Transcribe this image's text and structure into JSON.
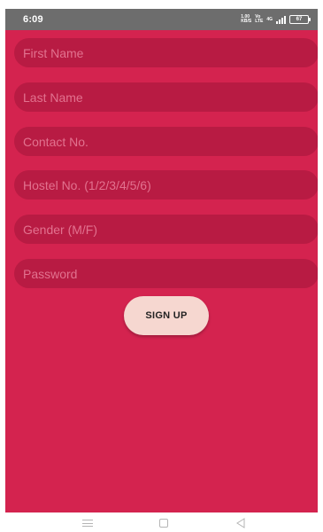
{
  "status_bar": {
    "time": "6:09",
    "speed_value": "1.00",
    "speed_unit": "KB/S",
    "net_top": "Vo",
    "net_bottom": "LTE",
    "signal_label": "4G",
    "battery": "67"
  },
  "form": {
    "first_name_placeholder": "First Name",
    "last_name_placeholder": "Last Name",
    "contact_placeholder": "Contact No.",
    "hostel_placeholder": "Hostel No. (1/2/3/4/5/6)",
    "gender_placeholder": "Gender (M/F)",
    "password_placeholder": "Password",
    "signup_label": "SIGN UP"
  },
  "colors": {
    "background": "#d4234f",
    "field": "#b81b43",
    "placeholder": "#e2728f",
    "button": "#f6d7d0",
    "status_bar": "#6d6d6d"
  },
  "nav": {
    "menu_icon": "menu-icon",
    "home_icon": "square-home-icon",
    "back_icon": "triangle-back-icon"
  }
}
